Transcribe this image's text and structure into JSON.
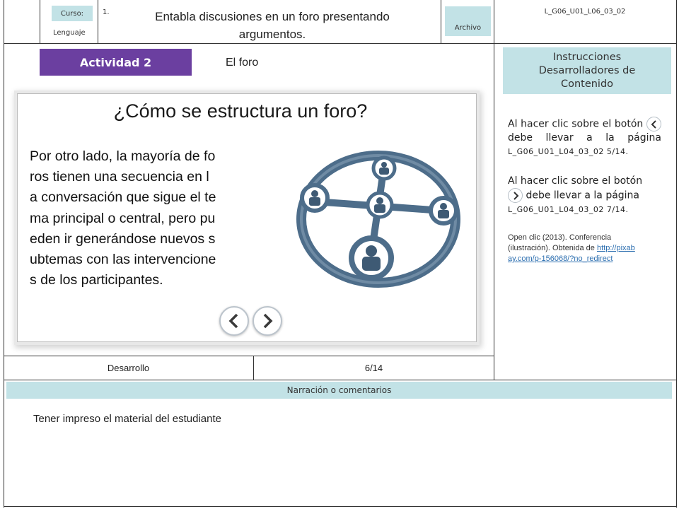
{
  "header": {
    "curso_label": "Curso:",
    "course_name": "Lenguaje",
    "item_number": "1.",
    "title_line1": "Entabla discusiones en un foro presentando",
    "title_line2": "argumentos.",
    "archivo_label": "Archivo",
    "code": "L_G06_U01_L06_03_02"
  },
  "activity": {
    "badge": "Actividad 2",
    "name": "El foro"
  },
  "slide": {
    "heading": "¿Cómo se estructura un foro?",
    "body_lines": [
      "Por otro lado, la mayoría de fo",
      "ros tienen una secuencia en l",
      "a conversación que sigue el te",
      "ma principal o central, pero pu",
      "eden ir generándose nuevos s",
      "ubtemas con las intervencione",
      "s de los participantes."
    ],
    "prev_icon": "chevron-left-icon",
    "next_icon": "chevron-right-icon",
    "illustration_icon": "network-people-icon"
  },
  "footer_row": {
    "section": "Desarrollo",
    "page": "6/14"
  },
  "sidebar": {
    "title": "Instrucciones Desarrolladores de Contenido",
    "instr1_pre": "Al hacer clic sobre el botón",
    "instr1_post": "debe llevar a la página",
    "instr1_code": "L_G06_U01_L04_03_02 5/14.",
    "instr2_pre": "Al hacer clic sobre el botón",
    "instr2_post": "debe llevar a la página",
    "instr2_code": "L_G06_U01_L04_03_02 7/14.",
    "credit": "Open clic (2013). Conferencia (ilustración). Obtenida de",
    "credit_link": "http://pixabay.com/p-156068/?no_redirect"
  },
  "narration": {
    "label": "Narración o comentarios",
    "text": "Tener impreso el material del estudiante"
  },
  "colors": {
    "accent_purple": "#6b3fa0",
    "tag_teal": "#c2e2e6",
    "network_blue": "#4d6d8a"
  }
}
